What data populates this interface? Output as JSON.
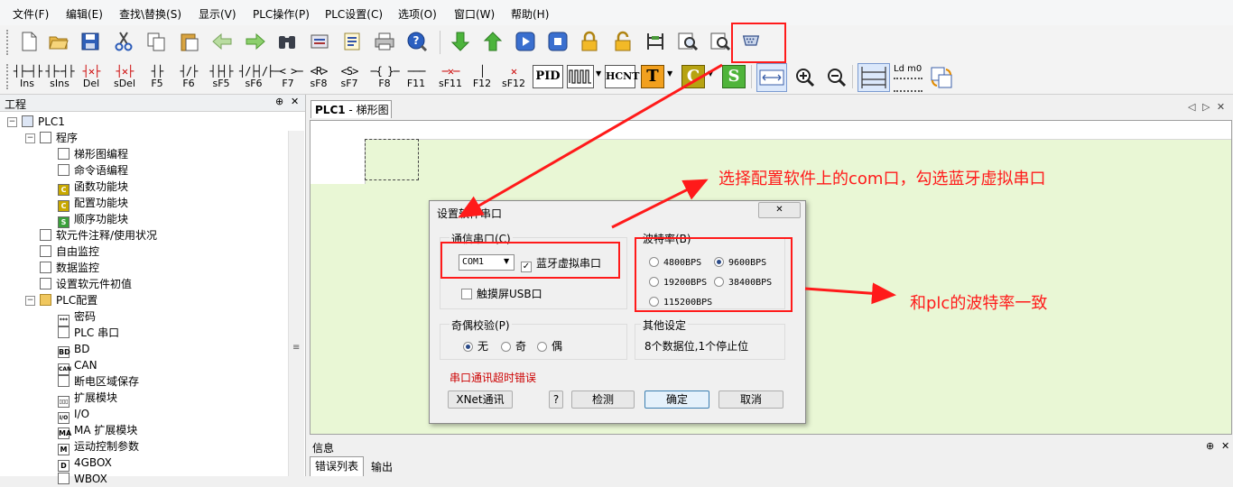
{
  "menu": [
    "文件(F)",
    "编辑(E)",
    "查找\\替换(S)",
    "显示(V)",
    "PLC操作(P)",
    "PLC设置(C)",
    "选项(O)",
    "窗口(W)",
    "帮助(H)"
  ],
  "toolbar2": {
    "buttons": [
      {
        "glyph": "┤├─┤├",
        "label": "Ins"
      },
      {
        "glyph": "┤├╌┤├",
        "label": "sIns"
      },
      {
        "glyph": "┤✕├",
        "label": "Del"
      },
      {
        "glyph": "┤✕├",
        "label": "sDel"
      },
      {
        "glyph": "┤├",
        "label": "F5"
      },
      {
        "glyph": "┤/├",
        "label": "F6"
      },
      {
        "glyph": "┤├┤├",
        "label": "sF5"
      },
      {
        "glyph": "┤/├┤/├",
        "label": "sF6"
      },
      {
        "glyph": "─< >─",
        "label": "F7"
      },
      {
        "glyph": "<R>",
        "label": "sF8"
      },
      {
        "glyph": "<S>",
        "label": "sF7"
      },
      {
        "glyph": "─{ }─",
        "label": "F8"
      },
      {
        "glyph": "───",
        "label": "F11"
      },
      {
        "glyph": "─✕─",
        "label": "sF11"
      },
      {
        "glyph": "│",
        "label": "F12"
      },
      {
        "glyph": "✕",
        "label": "sF12"
      }
    ],
    "pid": "PID",
    "hcnt": "HCNT",
    "t": "T",
    "c": "C",
    "s": "S",
    "ld_label": "Ld m0"
  },
  "left_panel": {
    "title": "工程",
    "pin": "⊕",
    "close": "✕",
    "tree": [
      {
        "label": "PLC1",
        "level": 0,
        "icon": "plc-icon",
        "expander": "−"
      },
      {
        "label": "程序",
        "level": 1,
        "icon": "program-icon",
        "expander": "−"
      },
      {
        "label": "梯形图编程",
        "level": 2,
        "icon": "ladder-icon"
      },
      {
        "label": "命令语编程",
        "level": 2,
        "icon": "instruction-icon"
      },
      {
        "label": "函数功能块",
        "level": 2,
        "icon": "function-block-icon",
        "badge": "C"
      },
      {
        "label": "配置功能块",
        "level": 2,
        "icon": "config-block-icon",
        "badge": "C"
      },
      {
        "label": "顺序功能块",
        "level": 2,
        "icon": "sequence-block-icon",
        "badge": "S"
      },
      {
        "label": "软元件注释/使用状况",
        "level": 1,
        "icon": "comment-icon"
      },
      {
        "label": "自由监控",
        "level": 1,
        "icon": "monitor-icon"
      },
      {
        "label": "数据监控",
        "level": 1,
        "icon": "data-monitor-icon"
      },
      {
        "label": "设置软元件初值",
        "level": 1,
        "icon": "init-value-icon"
      },
      {
        "label": "PLC配置",
        "level": 1,
        "icon": "folder-icon",
        "expander": "−"
      },
      {
        "label": "密码",
        "level": 2,
        "icon": "password-icon",
        "badge": "***"
      },
      {
        "label": "PLC 串口",
        "level": 2,
        "icon": "serial-port-icon"
      },
      {
        "label": "BD",
        "level": 2,
        "icon": "bd-icon",
        "badge": "BD"
      },
      {
        "label": "CAN",
        "level": 2,
        "icon": "can-icon",
        "badge": "CAN"
      },
      {
        "label": "断电区域保存",
        "level": 2,
        "icon": "power-save-icon"
      },
      {
        "label": "扩展模块",
        "level": 2,
        "icon": "expansion-icon",
        "badge": "▯▯▯"
      },
      {
        "label": "I/O",
        "level": 2,
        "icon": "io-icon",
        "badge": "I/O"
      },
      {
        "label": "MA 扩展模块",
        "level": 2,
        "icon": "ma-icon",
        "badge": "MA"
      },
      {
        "label": "运动控制参数",
        "level": 2,
        "icon": "motion-icon",
        "badge": "M"
      },
      {
        "label": "4GBOX",
        "level": 2,
        "icon": "4gbox-icon",
        "badge": "D"
      },
      {
        "label": "WBOX",
        "level": 2,
        "icon": "wbox-icon"
      }
    ]
  },
  "doc": {
    "tab_bold": "PLC1",
    "tab_rest": " - 梯形图",
    "nav": "◁ ▷ ✕"
  },
  "dialog": {
    "title": "设置软件串口",
    "close": "✕",
    "comm_group": "通信串口(C)",
    "com_value": "COM1",
    "bt_checkbox": "蓝牙虚拟串口",
    "bt_checked": true,
    "usb_checkbox": "触摸屏USB口",
    "usb_checked": false,
    "baud_group": "波特率(B)",
    "bauds": [
      {
        "label": "4800BPS",
        "checked": false
      },
      {
        "label": "9600BPS",
        "checked": true
      },
      {
        "label": "19200BPS",
        "checked": false
      },
      {
        "label": "38400BPS",
        "checked": false
      },
      {
        "label": "115200BPS",
        "checked": false
      }
    ],
    "parity_group": "奇偶校验(P)",
    "parity": [
      {
        "label": "无",
        "checked": true
      },
      {
        "label": "奇",
        "checked": false
      },
      {
        "label": "偶",
        "checked": false
      }
    ],
    "other_group": "其他设定",
    "other_text": "8个数据位,1个停止位",
    "error_text": "串口通讯超时错误",
    "btn_xnet": "XNet通讯",
    "btn_help": "?",
    "btn_detect": "检测",
    "btn_ok": "确定",
    "btn_cancel": "取消"
  },
  "info_panel": {
    "title": "信息",
    "tabs": [
      "错误列表",
      "输出"
    ]
  },
  "annotations": {
    "com": "选择配置软件上的com口，勾选蓝牙虚拟串口",
    "baud": "和plc的波特率一致"
  },
  "colors": {
    "annotation": "#ff1a1a",
    "ladder_bg": "#e9f7d5",
    "error_text": "#cc0000"
  }
}
